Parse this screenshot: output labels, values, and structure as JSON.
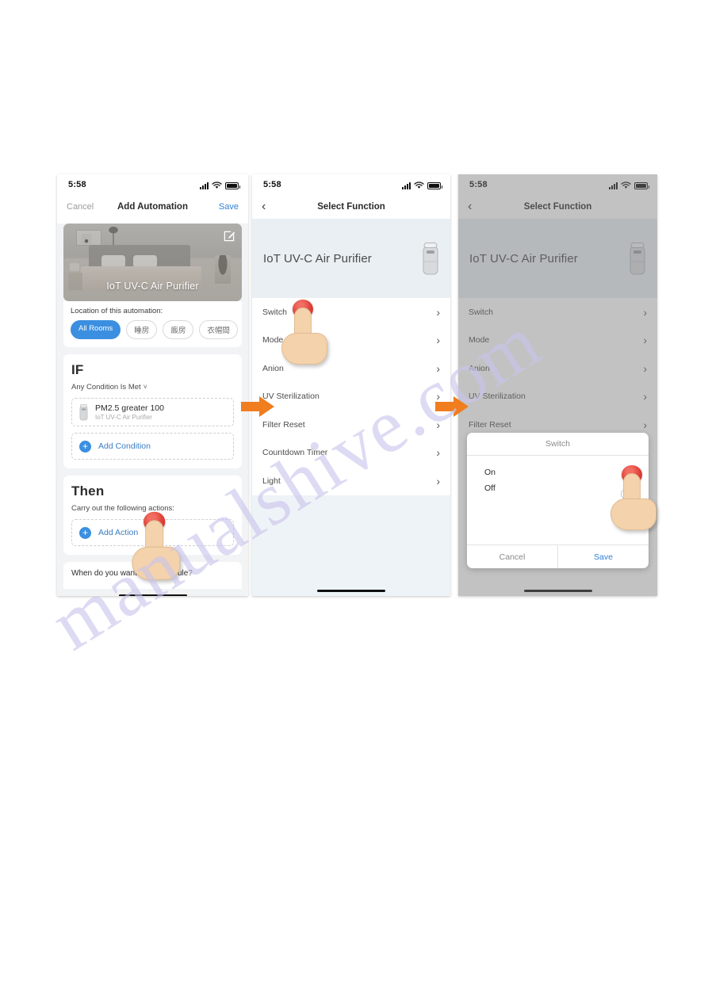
{
  "watermark": "manualshive.com",
  "phones": [
    {
      "id": "phone1",
      "status": {
        "time": "5:58",
        "location_arrow": "➤"
      },
      "nav": {
        "left": "Cancel",
        "title": "Add Automation",
        "right": "Save"
      },
      "hero": {
        "device_name": "IoT UV-C Air Purifier",
        "edit_icon": "edit-icon"
      },
      "location": {
        "label": "Location of this automation:",
        "rooms": [
          "All Rooms",
          "睡房",
          "廄房",
          "衣帽間"
        ],
        "selected": "All Rooms"
      },
      "if_section": {
        "title": "IF",
        "condition_mode": "Any Condition Is Met",
        "condition": {
          "title": "PM2.5 greater 100",
          "subtitle": "IoT UV-C Air Purifier"
        },
        "add_label": "Add Condition"
      },
      "then_section": {
        "title": "Then",
        "subtitle": "Carry out the following actions:",
        "add_label": "Add Action"
      },
      "when_section": {
        "text": "When do you want to run the rule?"
      }
    },
    {
      "id": "phone2",
      "status": {
        "time": "5:58"
      },
      "nav": {
        "title": "Select Function"
      },
      "device": {
        "name": "IoT UV-C Air Purifier"
      },
      "functions": [
        "Switch",
        "Mode",
        "Anion",
        "UV Sterilization",
        "Filter Reset",
        "Countdown Timer",
        "Light"
      ]
    },
    {
      "id": "phone3",
      "status": {
        "time": "5:58"
      },
      "nav": {
        "title": "Select Function"
      },
      "device": {
        "name": "IoT UV-C Air Purifier"
      },
      "functions": [
        "Switch",
        "Mode",
        "Anion",
        "UV Sterilization",
        "Filter Reset"
      ],
      "modal": {
        "title": "Switch",
        "options": [
          "On",
          "Off"
        ],
        "cancel": "Cancel",
        "save": "Save"
      }
    }
  ],
  "colors": {
    "accent_blue": "#3b8fe0",
    "link_blue": "#2f7fd6",
    "arrow_orange": "#f07d1e",
    "tap_red": "#e0443b",
    "hand_skin": "#f3d2ac",
    "panel_bg": "#eaeff3"
  }
}
